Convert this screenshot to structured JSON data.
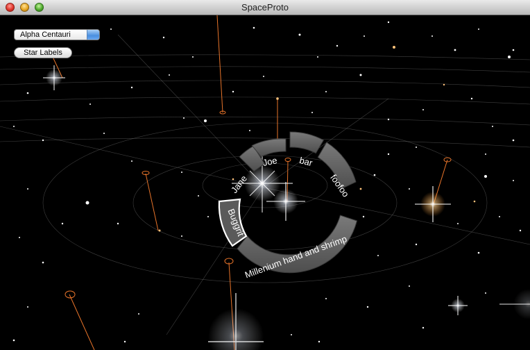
{
  "window": {
    "title": "SpaceProto"
  },
  "controls": {
    "star_selector": {
      "selected": "Alpha Centauri"
    },
    "star_labels_button": "Star Labels"
  },
  "pie_menu": {
    "items": [
      {
        "label": "Jane"
      },
      {
        "label": "Joe"
      },
      {
        "label": "bar"
      },
      {
        "label": "foofoo"
      },
      {
        "label": "Millenium hand and shrimp"
      },
      {
        "label": "Buggrit",
        "highlighted": true
      }
    ]
  }
}
